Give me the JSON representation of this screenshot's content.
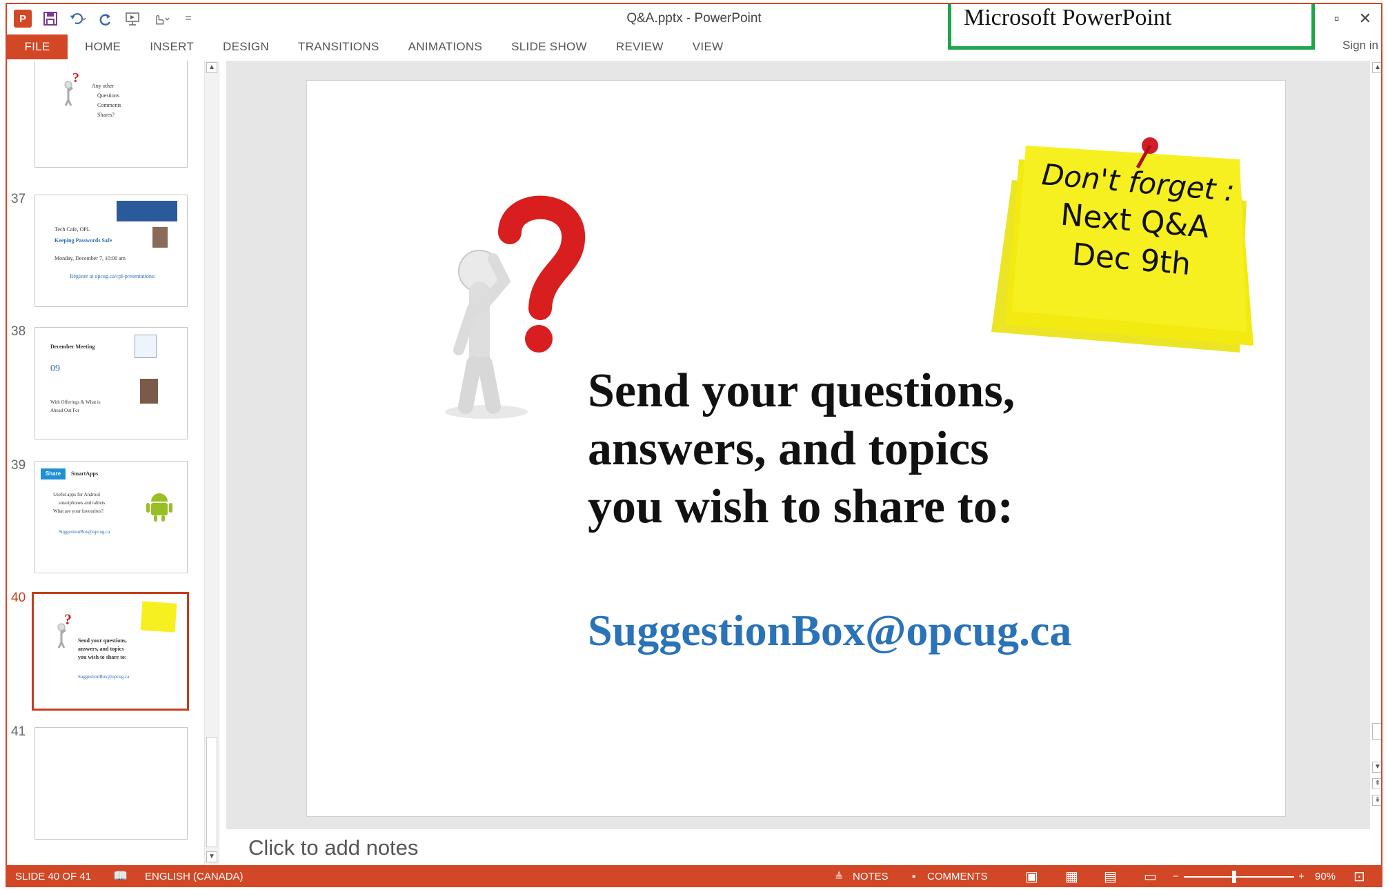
{
  "window": {
    "title": "Q&A.pptx - PowerPoint"
  },
  "callout": {
    "text": "Microsoft PowerPoint"
  },
  "quick_access": {
    "app_icon": "P",
    "items": [
      "save-icon",
      "undo-icon",
      "redo-icon",
      "touch-mode-icon",
      "customize-icon"
    ]
  },
  "ribbon": {
    "tabs": [
      "FILE",
      "HOME",
      "INSERT",
      "DESIGN",
      "TRANSITIONS",
      "ANIMATIONS",
      "SLIDE SHOW",
      "REVIEW",
      "VIEW"
    ],
    "sign_in": "Sign in"
  },
  "thumbnails": {
    "slide36": {
      "lines": [
        "Any other",
        "Questions",
        "Comments",
        "Shares?"
      ]
    },
    "slide37": {
      "number": "37",
      "lines": [
        "Tech Cafe, OPL",
        "Keeping Passwords Safe",
        "Monday, December 7, 10:00 am",
        "Register at opcug.ca/cpl-presentations/"
      ]
    },
    "slide38": {
      "number": "38",
      "lines": [
        "December Meeting",
        "09",
        "With Offerings & What is",
        "Ahead Out For"
      ]
    },
    "slide39": {
      "number": "39",
      "badge": "Share",
      "title": "SmartApps",
      "lines": [
        "Useful apps for Android",
        "smartphones and tablets",
        "What are your favourites?",
        "SuggestionBox@opcug.ca"
      ]
    },
    "slide40": {
      "number": "40",
      "lines": [
        "Send your questions,",
        "answers, and topics",
        "you wish to share to:",
        "SuggestionBox@opcug.ca"
      ]
    },
    "slide41": {
      "number": "41"
    }
  },
  "slide": {
    "line1": "Send your questions,",
    "line2": "answers, and topics",
    "line3": "you wish to share to:",
    "email": "SuggestionBox@opcug.ca",
    "sticky_line1": "Don't forget :",
    "sticky_line2": "Next Q&A",
    "sticky_line3": "Dec 9th"
  },
  "notes": {
    "placeholder": "Click to add notes"
  },
  "status": {
    "slide_position": "SLIDE 40 OF 41",
    "language": "ENGLISH (CANADA)",
    "notes": "NOTES",
    "comments": "COMMENTS",
    "zoom": "90%"
  },
  "colors": {
    "accent": "#d24726",
    "link": "#2a73b8",
    "callout_border": "#1fa54b",
    "sticky": "#f7f020"
  }
}
